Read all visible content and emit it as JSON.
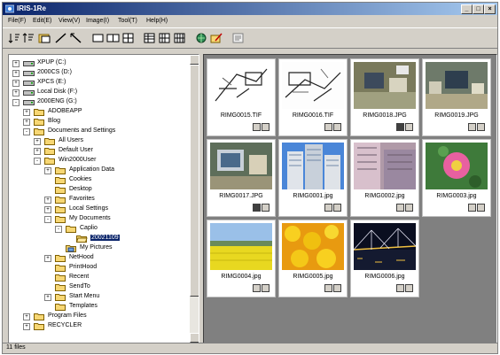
{
  "window": {
    "title": "IRIS-1Re"
  },
  "menubar": [
    {
      "label": "File(F)"
    },
    {
      "label": "Edit(E)"
    },
    {
      "label": "View(V)"
    },
    {
      "label": "Image(I)"
    },
    {
      "label": "Tool(T)"
    },
    {
      "label": "Help(H)"
    }
  ],
  "toolbar": {
    "buttons": [
      "sort-icon",
      "filter-icon",
      "folder-image-icon",
      "line-icon",
      "arrow-line-icon",
      "frame-single-icon",
      "frame-double-icon",
      "grid-icon",
      "list-icon",
      "detail-icon",
      "thumbnail-icon",
      "globe-icon",
      "edit-image-icon",
      "print-icon"
    ]
  },
  "tree": {
    "items": [
      {
        "label": "XPUP (C:)",
        "depth": 1,
        "icon": "drive-icon",
        "expander": "+"
      },
      {
        "label": "2000CS (D:)",
        "depth": 1,
        "icon": "drive-icon",
        "expander": "+"
      },
      {
        "label": "XPCS (E:)",
        "depth": 1,
        "icon": "drive-icon",
        "expander": "+"
      },
      {
        "label": "Local Disk (F:)",
        "depth": 1,
        "icon": "drive-icon",
        "expander": "+"
      },
      {
        "label": "2000ENG (G:)",
        "depth": 1,
        "icon": "drive-icon",
        "expander": "-"
      },
      {
        "label": "ADOBEAPP",
        "depth": 2,
        "icon": "folder-icon",
        "expander": "+"
      },
      {
        "label": "Blog",
        "depth": 2,
        "icon": "folder-icon",
        "expander": "+"
      },
      {
        "label": "Documents and Settings",
        "depth": 2,
        "icon": "folder-icon",
        "expander": "-"
      },
      {
        "label": "All Users",
        "depth": 3,
        "icon": "folder-icon",
        "expander": "+"
      },
      {
        "label": "Default User",
        "depth": 3,
        "icon": "folder-icon",
        "expander": "+"
      },
      {
        "label": "Win2000User",
        "depth": 3,
        "icon": "folder-icon",
        "expander": "-"
      },
      {
        "label": "Application Data",
        "depth": 4,
        "icon": "folder-icon",
        "expander": "+"
      },
      {
        "label": "Cookies",
        "depth": 4,
        "icon": "folder-icon",
        "expander": ""
      },
      {
        "label": "Desktop",
        "depth": 4,
        "icon": "folder-icon",
        "expander": ""
      },
      {
        "label": "Favorites",
        "depth": 4,
        "icon": "folder-icon",
        "expander": "+"
      },
      {
        "label": "Local Settings",
        "depth": 4,
        "icon": "folder-icon",
        "expander": "+"
      },
      {
        "label": "My Documents",
        "depth": 4,
        "icon": "folder-icon",
        "expander": "-"
      },
      {
        "label": "Caplio",
        "depth": 5,
        "icon": "folder-icon",
        "expander": "-"
      },
      {
        "label": "20021109",
        "depth": 6,
        "icon": "folder-open-icon",
        "expander": "",
        "selected": true
      },
      {
        "label": "My Pictures",
        "depth": 5,
        "icon": "pictures-folder-icon",
        "expander": ""
      },
      {
        "label": "NetHood",
        "depth": 4,
        "icon": "folder-icon",
        "expander": "+"
      },
      {
        "label": "PrintHood",
        "depth": 4,
        "icon": "folder-icon",
        "expander": ""
      },
      {
        "label": "Recent",
        "depth": 4,
        "icon": "folder-icon",
        "expander": ""
      },
      {
        "label": "SendTo",
        "depth": 4,
        "icon": "folder-icon",
        "expander": ""
      },
      {
        "label": "Start Menu",
        "depth": 4,
        "icon": "folder-icon",
        "expander": "+"
      },
      {
        "label": "Templates",
        "depth": 4,
        "icon": "folder-icon",
        "expander": ""
      },
      {
        "label": "Program Files",
        "depth": 2,
        "icon": "folder-icon",
        "expander": "+"
      },
      {
        "label": "RECYCLER",
        "depth": 2,
        "icon": "folder-icon",
        "expander": "+"
      }
    ]
  },
  "thumbnails": [
    {
      "name": "RIMG0015.TIF",
      "image": "sketch-drawing",
      "tag1_on": false
    },
    {
      "name": "RIMG0016.TIF",
      "image": "sketch-drawing-2",
      "tag1_on": false
    },
    {
      "name": "RIMG0018.JPG",
      "image": "office-desk",
      "tag1_on": true
    },
    {
      "name": "RIMG0019.JPG",
      "image": "office-desk-2",
      "tag1_on": false
    },
    {
      "name": "RIMG0017.JPG",
      "image": "office-monitor",
      "tag1_on": true
    },
    {
      "name": "RIMG0001.jpg",
      "image": "skyscrapers",
      "tag1_on": false
    },
    {
      "name": "RIMG0002.jpg",
      "image": "buildings-pink",
      "tag1_on": false
    },
    {
      "name": "RIMG0003.jpg",
      "image": "pink-flower",
      "tag1_on": false
    },
    {
      "name": "RIMG0004.jpg",
      "image": "rapeseed-field",
      "tag1_on": false
    },
    {
      "name": "RIMG0005.jpg",
      "image": "yellow-flowers",
      "tag1_on": false
    },
    {
      "name": "RIMG0006.jpg",
      "image": "night-bridge",
      "tag1_on": false
    }
  ],
  "status": {
    "text": "11 files"
  },
  "colors": {
    "titlebar_start": "#0a246a",
    "titlebar_end": "#a6caf0",
    "selection": "#0a246a",
    "face": "#d4d0c8",
    "folder": "#f7d774"
  }
}
